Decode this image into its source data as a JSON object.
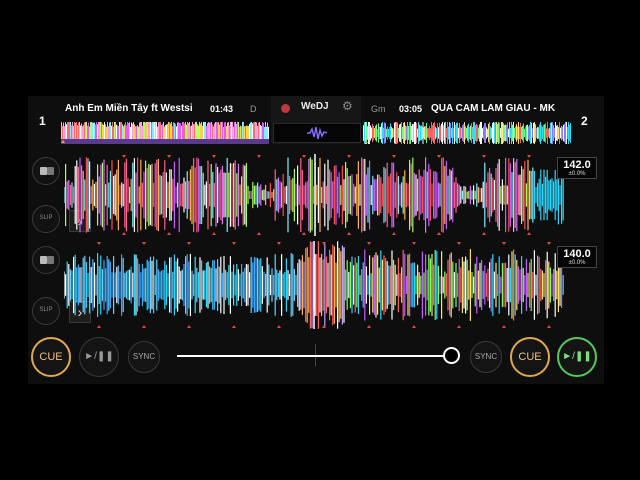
{
  "deck1": {
    "number": "1",
    "title": "Anh Em Miền Tây ft Westsi",
    "time": "01:43",
    "key": "D",
    "bpm": "142.0",
    "pitch": "±0.0%",
    "button_label": "SLIP",
    "cue_label": "CUE",
    "play_label": "►/❚❚",
    "sync_label": "SYNC"
  },
  "deck2": {
    "number": "2",
    "title": "QUA CAM LAM GIAU - MK",
    "time": "03:05",
    "key": "Gm",
    "bpm": "140.0",
    "pitch": "±0.0%",
    "button_label": "SLIP",
    "cue_label": "CUE",
    "play_label": "►/❚❚",
    "sync_label": "SYNC"
  },
  "center": {
    "logo": "WeDJ",
    "gear_icon": "gear-icon",
    "record_icon": "record-icon"
  },
  "crossfader": {
    "position": 1.0
  },
  "colors": {
    "cue": "#e0a94c",
    "play_active": "#55c95c",
    "record": "#c0393b",
    "marker": "#e04848"
  }
}
